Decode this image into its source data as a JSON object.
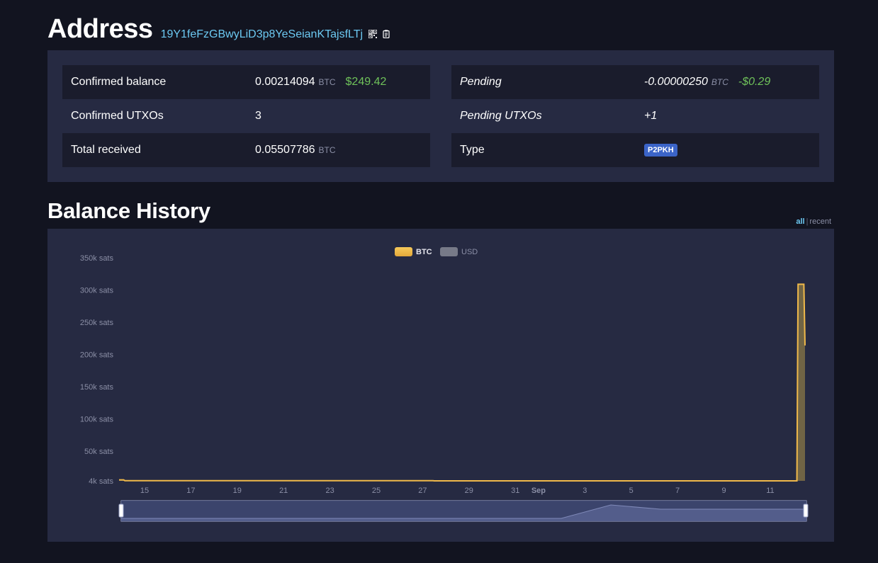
{
  "header": {
    "title": "Address",
    "address": "19Y1feFzGBwyLiD3p8YeSeianKTajsfLTj",
    "icons": [
      "qr-code-icon",
      "copy-icon"
    ]
  },
  "summary": {
    "left": [
      {
        "label": "Confirmed balance",
        "value": "0.00214094",
        "unit": "BTC",
        "usd": "$249.42"
      },
      {
        "label": "Confirmed UTXOs",
        "value": "3"
      },
      {
        "label": "Total received",
        "value": "0.05507786",
        "unit": "BTC"
      }
    ],
    "right": [
      {
        "label": "Pending",
        "value": "-0.00000250",
        "unit": "BTC",
        "usd": "-$0.29"
      },
      {
        "label": "Pending UTXOs",
        "value": "+1"
      },
      {
        "label": "Type",
        "badge": "P2PKH"
      }
    ]
  },
  "balance_history": {
    "title": "Balance History",
    "range_links": {
      "all": "all",
      "separator": "|",
      "recent": "recent"
    }
  },
  "colors": {
    "btc_series": "#f0b94a",
    "usd_series": "#777a88",
    "accent_link": "#6cc9f2",
    "usd_value": "#6fc25a",
    "badge": "#3b64c8"
  },
  "chart_data": {
    "type": "area",
    "legend": [
      {
        "name": "BTC",
        "active": true
      },
      {
        "name": "USD",
        "active": false
      }
    ],
    "legend_position": "top-center",
    "y_ticks": [
      "4k sats",
      "50k sats",
      "100k sats",
      "150k sats",
      "200k sats",
      "250k sats",
      "300k sats",
      "350k sats"
    ],
    "y_tick_values": [
      4000,
      50000,
      100000,
      150000,
      200000,
      250000,
      300000,
      350000
    ],
    "x_ticks": [
      "15",
      "17",
      "19",
      "21",
      "23",
      "25",
      "27",
      "29",
      "31",
      "Sep",
      "3",
      "5",
      "7",
      "9",
      "11"
    ],
    "x_tick_days": [
      15,
      17,
      19,
      21,
      23,
      25,
      27,
      29,
      31,
      32,
      34,
      36,
      38,
      40,
      42
    ],
    "x_range_days": [
      13.9,
      43.5
    ],
    "ylim": [
      4000,
      350000
    ],
    "series": [
      {
        "name": "BTC",
        "x_days": [
          13.9,
          14.1,
          14.15,
          27.45,
          27.5,
          43.15,
          43.2,
          43.45,
          43.5
        ],
        "values": [
          5500,
          5500,
          4300,
          4300,
          4000,
          4000,
          309000,
          309000,
          214000
        ]
      }
    ],
    "grid": false
  }
}
